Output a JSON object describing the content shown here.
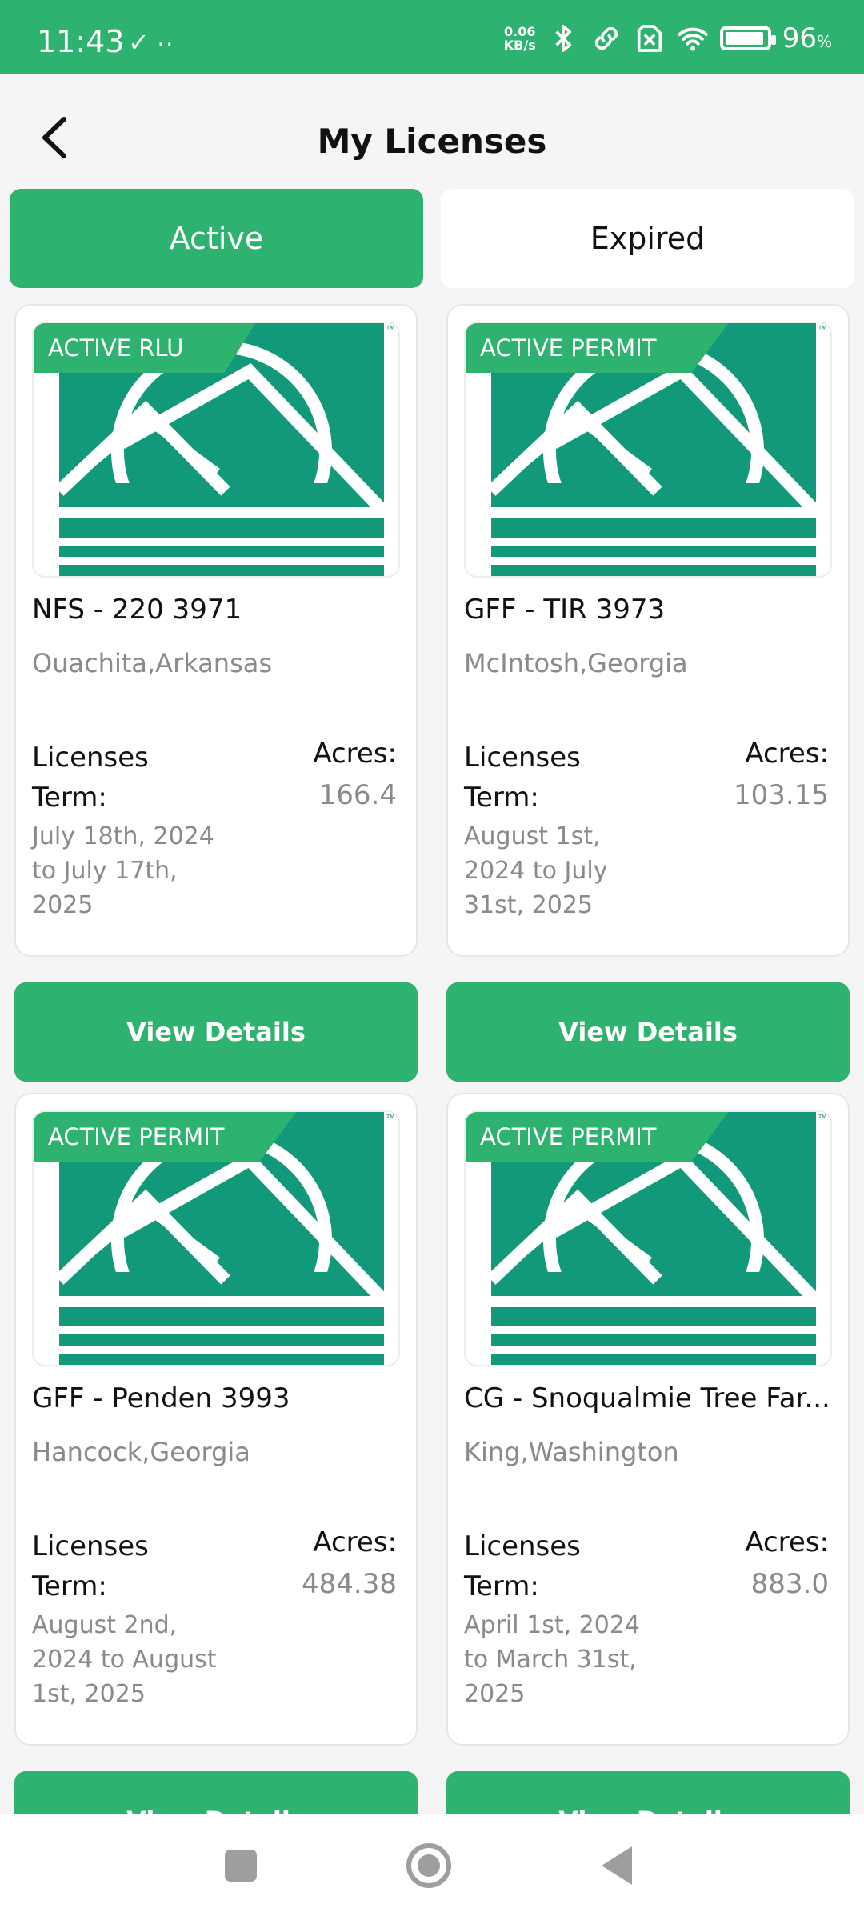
{
  "status_bar": {
    "time": "11:43",
    "left_icons": "✓ ··",
    "net_speed_value": "0.06",
    "net_speed_unit": "KB/s",
    "battery_level": 0.96,
    "battery_text": "96",
    "battery_unit": "%"
  },
  "header": {
    "title": "My Licenses"
  },
  "tabs": [
    {
      "label": "Active",
      "selected": true
    },
    {
      "label": "Expired",
      "selected": false
    }
  ],
  "cards": [
    {
      "badge": "ACTIVE RLU",
      "name": "NFS - 220 3971",
      "location": "Ouachita,Arkansas",
      "term_label": "Licenses Term:",
      "term": "July 18th, 2024 to July 17th, 2025",
      "acres_label": "Acres:",
      "acres": "166.4",
      "button": "View Details"
    },
    {
      "badge": "ACTIVE PERMIT",
      "name": "GFF - TIR 3973",
      "location": "McIntosh,Georgia",
      "term_label": "Licenses Term:",
      "term": "August 1st, 2024 to July 31st, 2025",
      "acres_label": "Acres:",
      "acres": "103.15",
      "button": "View Details"
    },
    {
      "badge": "ACTIVE PERMIT",
      "name": "GFF - Penden 3993",
      "location": "Hancock,Georgia",
      "term_label": "Licenses Term:",
      "term": "August 2nd, 2024 to August 1st, 2025",
      "acres_label": "Acres:",
      "acres": "484.38",
      "button": "View Details"
    },
    {
      "badge": "ACTIVE PERMIT",
      "name": "CG - Snoqualmie Tree Far...",
      "location": "King,Washington",
      "term_label": "Licenses Term:",
      "term": "April 1st, 2024 to March 31st, 2025",
      "acres_label": "Acres:",
      "acres": "883.0",
      "button": "View Details"
    }
  ],
  "logo": {
    "tm": "™",
    "color": "#12997a"
  },
  "colors": {
    "accent": "#2db36f",
    "muted_text": "#8a8a8a",
    "background": "#f5f5f5"
  },
  "icons": {
    "back": "chevron-left-icon",
    "bluetooth": "bluetooth-icon",
    "link": "link-icon",
    "sim": "no-sim-icon",
    "wifi": "wifi-icon",
    "battery": "battery-icon"
  }
}
